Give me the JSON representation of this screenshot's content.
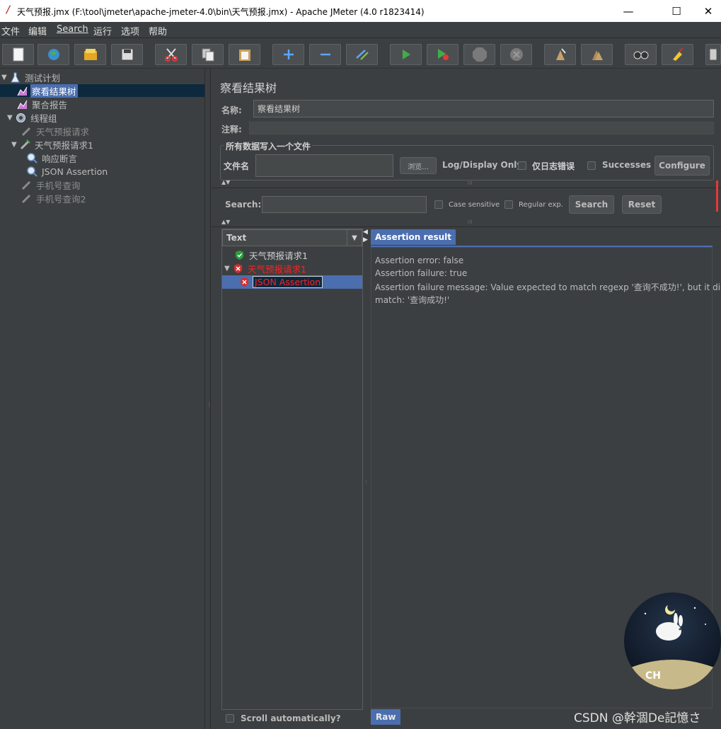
{
  "window": {
    "title": "天气预报.jmx (F:\\tool\\jmeter\\apache-jmeter-4.0\\bin\\天气预报.jmx) - Apache JMeter (4.0 r1823414)",
    "minimize": "—",
    "maximize": "☐",
    "close": "✕"
  },
  "menu": [
    "文件",
    "编辑",
    "Search",
    "运行",
    "选项",
    "帮助"
  ],
  "toolbar": [
    "new-icon",
    "templates-icon",
    "open-icon",
    "save-icon",
    "cut-icon",
    "copy-icon",
    "paste-icon",
    "expand-icon",
    "collapse-icon",
    "toggle-icon",
    "start-icon",
    "start-no-timers-icon",
    "stop-icon",
    "shutdown-icon",
    "clear-icon",
    "clear-all-icon",
    "search-icon",
    "reset-search-icon",
    "function-helper-icon"
  ],
  "tree": {
    "items": [
      {
        "label": "测试计划",
        "icon": "test-plan-icon"
      },
      {
        "label": "察看结果树",
        "icon": "listener-icon"
      },
      {
        "label": "聚合报告",
        "icon": "listener-icon"
      },
      {
        "label": "线程组",
        "icon": "thread-group-icon"
      },
      {
        "label": "天气预报请求",
        "icon": "sampler-icon"
      },
      {
        "label": "天气预报请求1",
        "icon": "sampler-icon"
      },
      {
        "label": "响应断言",
        "icon": "assertion-icon"
      },
      {
        "label": "JSON Assertion",
        "icon": "assertion-icon"
      },
      {
        "label": "手机号查询",
        "icon": "sampler-icon"
      },
      {
        "label": "手机号查询2",
        "icon": "sampler-icon"
      }
    ]
  },
  "panel": {
    "title": "察看结果树",
    "name_label": "名称:",
    "name_value": "察看结果树",
    "comment_label": "注释:",
    "comment_value": "",
    "file_group_title": "所有数据写入一个文件",
    "filename_label": "文件名",
    "filename_value": "",
    "browse_button": "浏览...",
    "log_display_label": "Log/Display Only:",
    "errors_only_label": "仅日志错误",
    "successes_label": "Successes",
    "configure_button": "Configure"
  },
  "search": {
    "label": "Search:",
    "value": "",
    "case_sensitive": "Case sensitive",
    "regex": "Regular exp.",
    "search_button": "Search",
    "reset_button": "Reset"
  },
  "results": {
    "renderer": "Text",
    "items": [
      {
        "label": "天气预报请求1",
        "status": "success"
      },
      {
        "label": "天气预报请求1",
        "status": "failed"
      },
      {
        "label": "JSON Assertion",
        "status": "failed"
      }
    ],
    "scroll_label": "Scroll automatically?"
  },
  "detail": {
    "tab": "Assertion result",
    "lines": [
      "Assertion error: false",
      "Assertion failure: true",
      "Assertion failure message: Value expected to match regexp '查询不成功!', but it did not",
      "match: '查询成功!'"
    ],
    "bottom_tab": "Raw"
  },
  "watermark": "CSDN @幹涸De記憶さ",
  "badge_text": "CH",
  "colors": {
    "background": "#3c3f41",
    "selection": "#4b6eaf",
    "error_text": "#ff0000",
    "success_green": "#2e9e3e"
  }
}
